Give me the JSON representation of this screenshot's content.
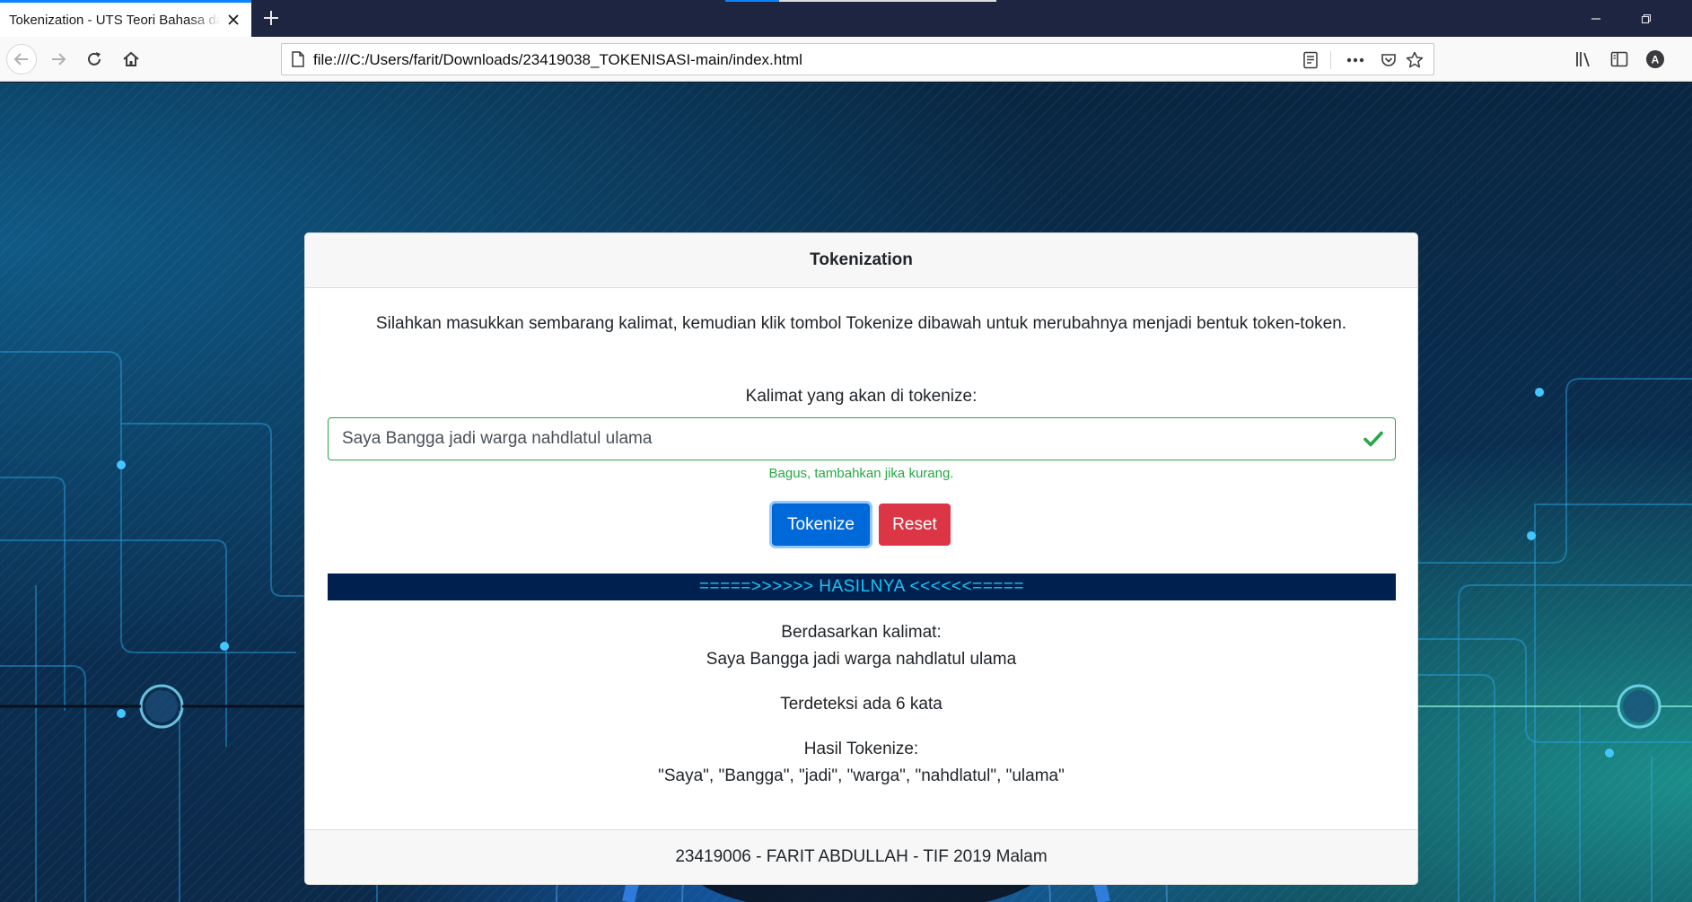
{
  "browser": {
    "tab_title": "Tokenization - UTS Teori Bahasa dan Automata",
    "url": "file:///C:/Users/farit/Downloads/23419038_TOKENISASI-main/index.html",
    "profile_initial": "A",
    "accent_color": "#0a84ff"
  },
  "card": {
    "header_title": "Tokenization",
    "intro_text": "Silahkan masukkan sembarang kalimat, kemudian klik tombol Tokenize dibawah untuk merubahnya menjadi bentuk token-token.",
    "input_label": "Kalimat yang akan di tokenize:",
    "input_value": "Saya Bangga jadi warga nahdlatul ulama",
    "valid_feedback": "Bagus, tambahkan jika kurang.",
    "tokenize_button": "Tokenize",
    "reset_button": "Reset",
    "result_banner": "=====>>>>>> HASILNYA <<<<<<=====",
    "based_on_label": "Berdasarkan kalimat:",
    "based_on_value": "Saya Bangga jadi warga nahdlatul ulama",
    "detected_text": "Terdeteksi ada 6 kata",
    "result_label": "Hasil Tokenize:",
    "result_value": "\"Saya\", \"Bangga\", \"jadi\", \"warga\", \"nahdlatul\", \"ulama\"",
    "footer_text": "23419006 - FARIT ABDULLAH - TIF 2019 Malam",
    "colors": {
      "primary": "#0069d9",
      "danger": "#dc3545",
      "success": "#28a745",
      "result_bar_bg": "#002050",
      "result_bar_text": "#17c6f5"
    }
  }
}
